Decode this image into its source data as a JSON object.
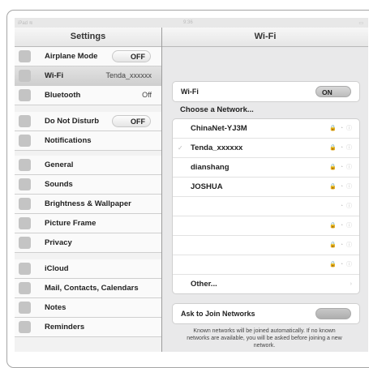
{
  "left": {
    "title": "Settings",
    "items": [
      {
        "label": "Airplane Mode",
        "toggle": "OFF"
      },
      {
        "label": "Wi-Fi",
        "value": "Tenda_xxxxxx"
      },
      {
        "label": "Bluetooth",
        "value": "Off"
      },
      {
        "label": "Do Not Disturb",
        "toggle": "OFF"
      },
      {
        "label": "Notifications"
      },
      {
        "label": "General"
      },
      {
        "label": "Sounds"
      },
      {
        "label": "Brightness & Wallpaper"
      },
      {
        "label": "Picture Frame"
      },
      {
        "label": "Privacy"
      },
      {
        "label": "iCloud"
      },
      {
        "label": "Mail, Contacts, Calendars"
      },
      {
        "label": "Notes"
      },
      {
        "label": "Reminders"
      }
    ]
  },
  "right": {
    "title": "Wi-Fi",
    "wifi_label": "Wi-Fi",
    "wifi_toggle": "ON",
    "choose_label": "Choose a Network...",
    "networks": [
      {
        "name": "ChinaNet-YJ3M"
      },
      {
        "name": "Tenda_xxxxxx",
        "selected": true
      },
      {
        "name": "dianshang"
      },
      {
        "name": "JOSHUA"
      },
      {
        "name": ""
      },
      {
        "name": ""
      },
      {
        "name": ""
      },
      {
        "name": ""
      }
    ],
    "other_label": "Other...",
    "ask_label": "Ask to Join Networks",
    "note": "Known networks will be joined automatically. If no known networks are available, you will be asked before joining a new network."
  }
}
